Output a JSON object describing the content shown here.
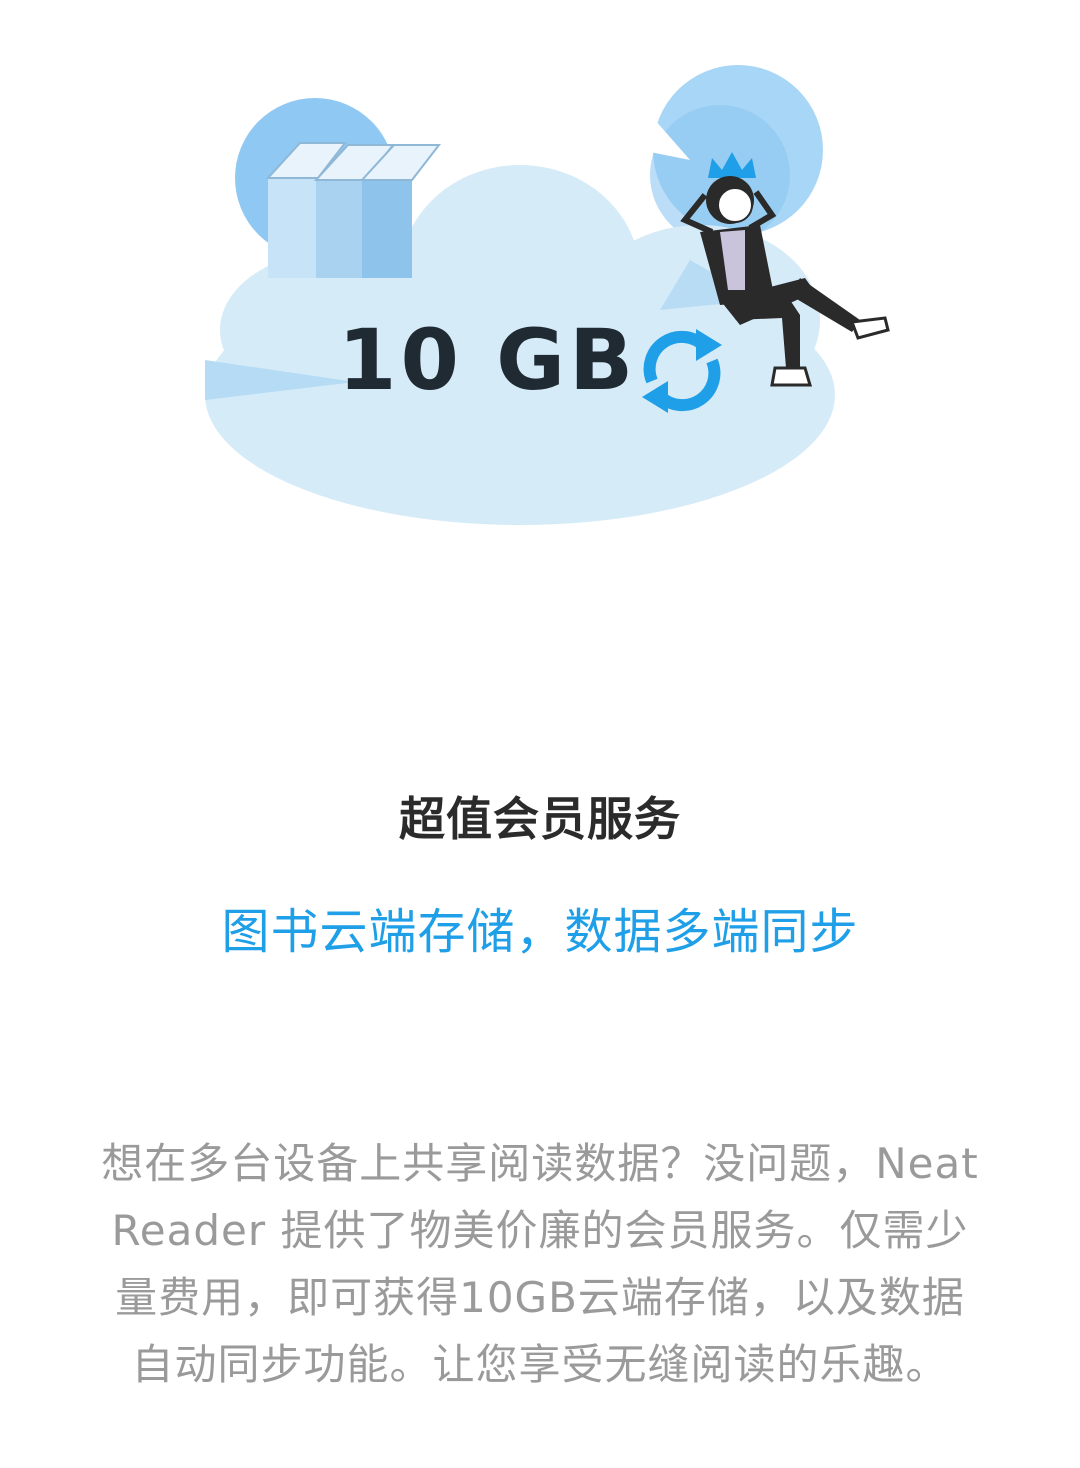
{
  "hero": {
    "storage_label": "10 GB",
    "accent_color": "#1e9fe8",
    "cloud_color": "#d6ebf8",
    "icons": [
      "books-icon",
      "sync-icon",
      "crown-icon",
      "person-figure"
    ]
  },
  "content": {
    "title": "超值会员服务",
    "subtitle": "图书云端存储，数据多端同步",
    "description": "想在多台设备上共享阅读数据？没问题，Neat Reader 提供了物美价廉的会员服务。仅需少量费用，即可获得10GB云端存储，以及数据自动同步功能。让您享受无缝阅读的乐趣。"
  }
}
